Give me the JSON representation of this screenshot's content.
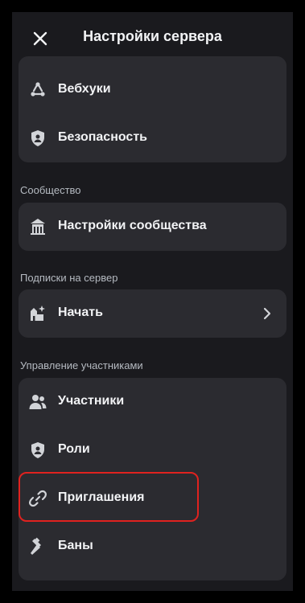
{
  "header": {
    "title": "Настройки сервера",
    "close_icon": "close-icon"
  },
  "cards": {
    "top": {
      "items": [
        {
          "label": "Вебхуки",
          "icon": "webhook-icon"
        },
        {
          "label": "Безопасность",
          "icon": "shield-icon"
        }
      ]
    },
    "community": {
      "section_label": "Сообщество",
      "items": [
        {
          "label": "Настройки сообщества",
          "icon": "community-icon"
        }
      ]
    },
    "subscriptions": {
      "section_label": "Подписки на сервер",
      "items": [
        {
          "label": "Начать",
          "icon": "subscriptions-icon",
          "chevron": "chevron-right-icon"
        }
      ]
    },
    "members": {
      "section_label": "Управление участниками",
      "items": [
        {
          "label": "Участники",
          "icon": "members-icon"
        },
        {
          "label": "Роли",
          "icon": "shield-icon"
        },
        {
          "label": "Приглашения",
          "icon": "link-icon",
          "highlighted": true,
          "highlight_color": "#e0221f"
        },
        {
          "label": "Баны",
          "icon": "ban-hammer-icon"
        }
      ]
    }
  },
  "colors": {
    "background": "#1a1a1e",
    "card": "#2b2b30",
    "text": "#f2f3f5",
    "muted": "#b5bac1",
    "highlight": "#e0221f"
  }
}
